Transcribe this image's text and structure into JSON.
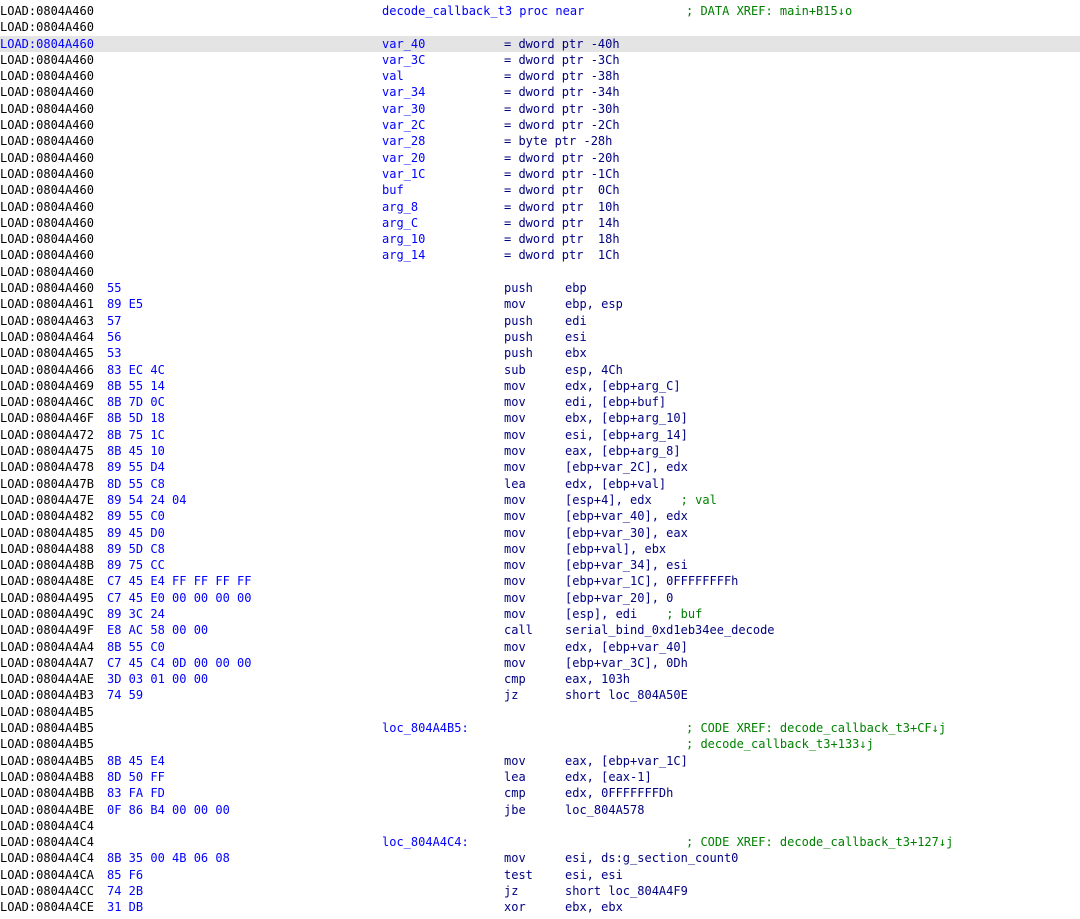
{
  "colors": {
    "address": "#000000",
    "highlight_address": "#0000ff",
    "bytes": "#0000ff",
    "label": "#0000ff",
    "mnemonic": "#000080",
    "operands": "#000080",
    "comment": "#008000",
    "highlight_row": "#e4e4e4"
  },
  "lines": [
    {
      "addr": "LOAD:0804A460",
      "bytes": "",
      "label": "decode_callback_t3 proc near",
      "mnem": "",
      "ops": "",
      "comment": "; DATA XREF: main+B15↓o"
    },
    {
      "addr": "LOAD:0804A460",
      "bytes": "",
      "label": "",
      "mnem": "",
      "ops": "",
      "comment": ""
    },
    {
      "addr": "LOAD:0804A460",
      "bytes": "",
      "label": "var_40",
      "mnem": "= dword ptr -40h",
      "ops": "",
      "comment": ""
    },
    {
      "addr": "LOAD:0804A460",
      "bytes": "",
      "label": "var_3C",
      "mnem": "= dword ptr -3Ch",
      "ops": "",
      "comment": ""
    },
    {
      "addr": "LOAD:0804A460",
      "bytes": "",
      "label": "val",
      "mnem": "= dword ptr -38h",
      "ops": "",
      "comment": ""
    },
    {
      "addr": "LOAD:0804A460",
      "bytes": "",
      "label": "var_34",
      "mnem": "= dword ptr -34h",
      "ops": "",
      "comment": ""
    },
    {
      "addr": "LOAD:0804A460",
      "bytes": "",
      "label": "var_30",
      "mnem": "= dword ptr -30h",
      "ops": "",
      "comment": ""
    },
    {
      "addr": "LOAD:0804A460",
      "bytes": "",
      "label": "var_2C",
      "mnem": "= dword ptr -2Ch",
      "ops": "",
      "comment": ""
    },
    {
      "addr": "LOAD:0804A460",
      "bytes": "",
      "label": "var_28",
      "mnem": "= byte ptr -28h",
      "ops": "",
      "comment": ""
    },
    {
      "addr": "LOAD:0804A460",
      "bytes": "",
      "label": "var_20",
      "mnem": "= dword ptr -20h",
      "ops": "",
      "comment": ""
    },
    {
      "addr": "LOAD:0804A460",
      "bytes": "",
      "label": "var_1C",
      "mnem": "= dword ptr -1Ch",
      "ops": "",
      "comment": ""
    },
    {
      "addr": "LOAD:0804A460",
      "bytes": "",
      "label": "buf",
      "mnem": "= dword ptr  0Ch",
      "ops": "",
      "comment": ""
    },
    {
      "addr": "LOAD:0804A460",
      "bytes": "",
      "label": "arg_8",
      "mnem": "= dword ptr  10h",
      "ops": "",
      "comment": ""
    },
    {
      "addr": "LOAD:0804A460",
      "bytes": "",
      "label": "arg_C",
      "mnem": "= dword ptr  14h",
      "ops": "",
      "comment": ""
    },
    {
      "addr": "LOAD:0804A460",
      "bytes": "",
      "label": "arg_10",
      "mnem": "= dword ptr  18h",
      "ops": "",
      "comment": ""
    },
    {
      "addr": "LOAD:0804A460",
      "bytes": "",
      "label": "arg_14",
      "mnem": "= dword ptr  1Ch",
      "ops": "",
      "comment": ""
    },
    {
      "addr": "LOAD:0804A460",
      "bytes": "",
      "label": "",
      "mnem": "",
      "ops": "",
      "comment": ""
    },
    {
      "addr": "LOAD:0804A460",
      "bytes": "55",
      "label": "",
      "mnem": "push",
      "ops": "ebp",
      "comment": ""
    },
    {
      "addr": "LOAD:0804A461",
      "bytes": "89 E5",
      "label": "",
      "mnem": "mov",
      "ops": "ebp, esp",
      "comment": ""
    },
    {
      "addr": "LOAD:0804A463",
      "bytes": "57",
      "label": "",
      "mnem": "push",
      "ops": "edi",
      "comment": ""
    },
    {
      "addr": "LOAD:0804A464",
      "bytes": "56",
      "label": "",
      "mnem": "push",
      "ops": "esi",
      "comment": ""
    },
    {
      "addr": "LOAD:0804A465",
      "bytes": "53",
      "label": "",
      "mnem": "push",
      "ops": "ebx",
      "comment": ""
    },
    {
      "addr": "LOAD:0804A466",
      "bytes": "83 EC 4C",
      "label": "",
      "mnem": "sub",
      "ops": "esp, 4Ch",
      "comment": ""
    },
    {
      "addr": "LOAD:0804A469",
      "bytes": "8B 55 14",
      "label": "",
      "mnem": "mov",
      "ops": "edx, [ebp+arg_C]",
      "comment": ""
    },
    {
      "addr": "LOAD:0804A46C",
      "bytes": "8B 7D 0C",
      "label": "",
      "mnem": "mov",
      "ops": "edi, [ebp+buf]",
      "comment": ""
    },
    {
      "addr": "LOAD:0804A46F",
      "bytes": "8B 5D 18",
      "label": "",
      "mnem": "mov",
      "ops": "ebx, [ebp+arg_10]",
      "comment": ""
    },
    {
      "addr": "LOAD:0804A472",
      "bytes": "8B 75 1C",
      "label": "",
      "mnem": "mov",
      "ops": "esi, [ebp+arg_14]",
      "comment": ""
    },
    {
      "addr": "LOAD:0804A475",
      "bytes": "8B 45 10",
      "label": "",
      "mnem": "mov",
      "ops": "eax, [ebp+arg_8]",
      "comment": ""
    },
    {
      "addr": "LOAD:0804A478",
      "bytes": "89 55 D4",
      "label": "",
      "mnem": "mov",
      "ops": "[ebp+var_2C], edx",
      "comment": ""
    },
    {
      "addr": "LOAD:0804A47B",
      "bytes": "8D 55 C8",
      "label": "",
      "mnem": "lea",
      "ops": "edx, [ebp+val]",
      "comment": ""
    },
    {
      "addr": "LOAD:0804A47E",
      "bytes": "89 54 24 04",
      "label": "",
      "mnem": "mov",
      "ops": "[esp+4], edx",
      "inline_comment": "; val",
      "comment": ""
    },
    {
      "addr": "LOAD:0804A482",
      "bytes": "89 55 C0",
      "label": "",
      "mnem": "mov",
      "ops": "[ebp+var_40], edx",
      "comment": ""
    },
    {
      "addr": "LOAD:0804A485",
      "bytes": "89 45 D0",
      "label": "",
      "mnem": "mov",
      "ops": "[ebp+var_30], eax",
      "comment": ""
    },
    {
      "addr": "LOAD:0804A488",
      "bytes": "89 5D C8",
      "label": "",
      "mnem": "mov",
      "ops": "[ebp+val], ebx",
      "comment": ""
    },
    {
      "addr": "LOAD:0804A48B",
      "bytes": "89 75 CC",
      "label": "",
      "mnem": "mov",
      "ops": "[ebp+var_34], esi",
      "comment": ""
    },
    {
      "addr": "LOAD:0804A48E",
      "bytes": "C7 45 E4 FF FF FF FF",
      "label": "",
      "mnem": "mov",
      "ops": "[ebp+var_1C], 0FFFFFFFFh",
      "comment": ""
    },
    {
      "addr": "LOAD:0804A495",
      "bytes": "C7 45 E0 00 00 00 00",
      "label": "",
      "mnem": "mov",
      "ops": "[ebp+var_20], 0",
      "comment": ""
    },
    {
      "addr": "LOAD:0804A49C",
      "bytes": "89 3C 24",
      "label": "",
      "mnem": "mov",
      "ops": "[esp], edi",
      "inline_comment": "; buf",
      "comment": ""
    },
    {
      "addr": "LOAD:0804A49F",
      "bytes": "E8 AC 58 00 00",
      "label": "",
      "mnem": "call",
      "ops": "serial_bind_0xd1eb34ee_decode",
      "comment": ""
    },
    {
      "addr": "LOAD:0804A4A4",
      "bytes": "8B 55 C0",
      "label": "",
      "mnem": "mov",
      "ops": "edx, [ebp+var_40]",
      "comment": ""
    },
    {
      "addr": "LOAD:0804A4A7",
      "bytes": "C7 45 C4 0D 00 00 00",
      "label": "",
      "mnem": "mov",
      "ops": "[ebp+var_3C], 0Dh",
      "comment": ""
    },
    {
      "addr": "LOAD:0804A4AE",
      "bytes": "3D 03 01 00 00",
      "label": "",
      "mnem": "cmp",
      "ops": "eax, 103h",
      "comment": ""
    },
    {
      "addr": "LOAD:0804A4B3",
      "bytes": "74 59",
      "label": "",
      "mnem": "jz",
      "ops": "short loc_804A50E",
      "comment": ""
    },
    {
      "addr": "LOAD:0804A4B5",
      "bytes": "",
      "label": "",
      "mnem": "",
      "ops": "",
      "comment": ""
    },
    {
      "addr": "LOAD:0804A4B5",
      "bytes": "",
      "label": "loc_804A4B5:",
      "mnem": "",
      "ops": "",
      "comment": "; CODE XREF: decode_callback_t3+CF↓j"
    },
    {
      "addr": "LOAD:0804A4B5",
      "bytes": "",
      "label": "",
      "mnem": "",
      "ops": "",
      "comment": "; decode_callback_t3+133↓j"
    },
    {
      "addr": "LOAD:0804A4B5",
      "bytes": "8B 45 E4",
      "label": "",
      "mnem": "mov",
      "ops": "eax, [ebp+var_1C]",
      "comment": ""
    },
    {
      "addr": "LOAD:0804A4B8",
      "bytes": "8D 50 FF",
      "label": "",
      "mnem": "lea",
      "ops": "edx, [eax-1]",
      "comment": ""
    },
    {
      "addr": "LOAD:0804A4BB",
      "bytes": "83 FA FD",
      "label": "",
      "mnem": "cmp",
      "ops": "edx, 0FFFFFFFDh",
      "comment": ""
    },
    {
      "addr": "LOAD:0804A4BE",
      "bytes": "0F 86 B4 00 00 00",
      "label": "",
      "mnem": "jbe",
      "ops": "loc_804A578",
      "comment": ""
    },
    {
      "addr": "LOAD:0804A4C4",
      "bytes": "",
      "label": "",
      "mnem": "",
      "ops": "",
      "comment": ""
    },
    {
      "addr": "LOAD:0804A4C4",
      "bytes": "",
      "label": "loc_804A4C4:",
      "mnem": "",
      "ops": "",
      "comment": "; CODE XREF: decode_callback_t3+127↓j"
    },
    {
      "addr": "LOAD:0804A4C4",
      "bytes": "8B 35 00 4B 06 08",
      "label": "",
      "mnem": "mov",
      "ops": "esi, ds:g_section_count0",
      "comment": ""
    },
    {
      "addr": "LOAD:0804A4CA",
      "bytes": "85 F6",
      "label": "",
      "mnem": "test",
      "ops": "esi, esi",
      "comment": ""
    },
    {
      "addr": "LOAD:0804A4CC",
      "bytes": "74 2B",
      "label": "",
      "mnem": "jz",
      "ops": "short loc_804A4F9",
      "comment": ""
    },
    {
      "addr": "LOAD:0804A4CE",
      "bytes": "31 DB",
      "label": "",
      "mnem": "xor",
      "ops": "ebx, ebx",
      "comment": ""
    }
  ]
}
